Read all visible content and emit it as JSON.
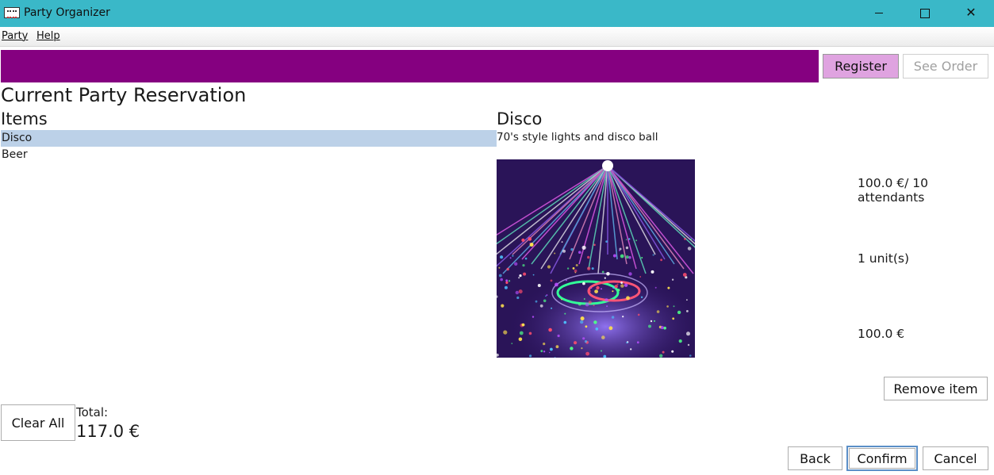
{
  "window": {
    "title": "Party Organizer",
    "controls": {
      "minimize": "minimize-icon",
      "maximize": "maximize-icon",
      "close": "close-icon"
    }
  },
  "menu": {
    "items": [
      {
        "label": "Party"
      },
      {
        "label": "Help"
      }
    ]
  },
  "toolbar": {
    "banner_color": "#850080",
    "register_label": "Register",
    "see_order_label": "See Order"
  },
  "main": {
    "heading": "Current Party Reservation",
    "items_heading": "Items",
    "items": [
      {
        "label": "Disco",
        "selected": true
      },
      {
        "label": "Beer",
        "selected": false
      }
    ]
  },
  "detail": {
    "title": "Disco",
    "description": "70's style lights and disco ball",
    "image": "disco-lights-photo",
    "price_per": "100.0 €/ 10 attendants",
    "units": "1 unit(s)",
    "item_total": "100.0 €",
    "remove_label": "Remove item"
  },
  "footer": {
    "clear_label": "Clear All",
    "total_label": "Total:",
    "total_value": "117.0 €",
    "back_label": "Back",
    "confirm_label": "Confirm",
    "cancel_label": "Cancel"
  },
  "colors": {
    "titlebar": "#3ab8c8",
    "register_bg": "#dfa3e0",
    "selection_bg": "#bcd1e8"
  }
}
